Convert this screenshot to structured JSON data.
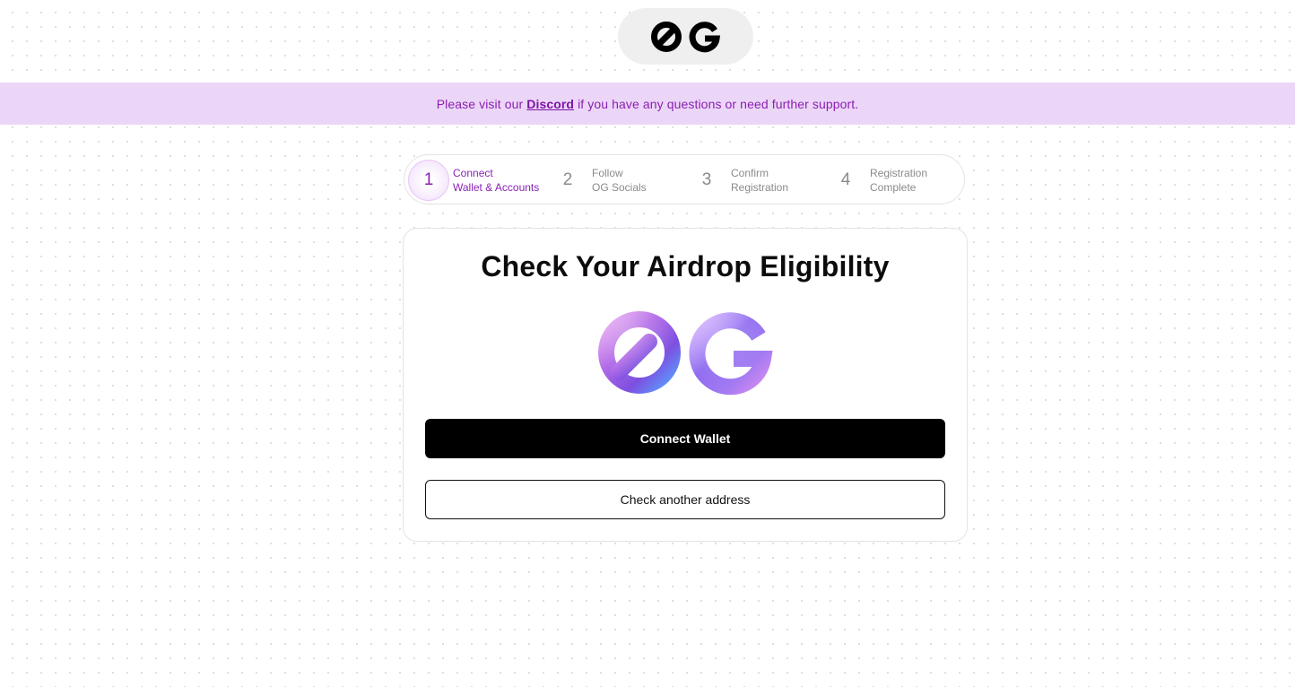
{
  "header": {
    "logo_icon": "og-logo-icon"
  },
  "banner": {
    "prefix": "Please visit our ",
    "link_text": "Discord",
    "suffix": " if you have any questions or need further support."
  },
  "stepper": {
    "steps": [
      {
        "number": "1",
        "line1": "Connect",
        "line2": "Wallet & Accounts",
        "active": true
      },
      {
        "number": "2",
        "line1": "Follow",
        "line2": "OG Socials",
        "active": false
      },
      {
        "number": "3",
        "line1": "Confirm",
        "line2": "Registration",
        "active": false
      },
      {
        "number": "4",
        "line1": "Registration",
        "line2": "Complete",
        "active": false
      }
    ]
  },
  "card": {
    "title": "Check Your Airdrop Eligibility",
    "hero_icon": "og-3d-logo-icon",
    "connect_label": "Connect Wallet",
    "check_label": "Check another address"
  },
  "colors": {
    "accent": "#8a22b5",
    "banner_bg": "#ecd6f8",
    "primary_button": "#000000"
  }
}
